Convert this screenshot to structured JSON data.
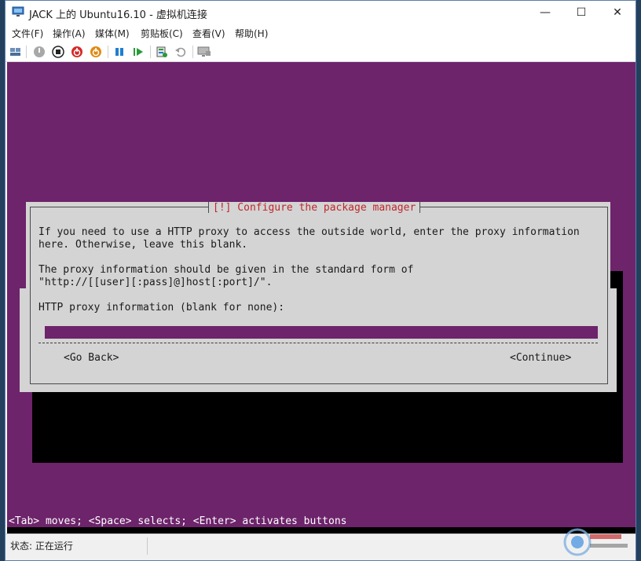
{
  "window": {
    "title": "JACK 上的 Ubuntu16.10 - 虚拟机连接",
    "minimize_glyph": "—",
    "maximize_glyph": "☐",
    "close_glyph": "✕"
  },
  "menu": {
    "items": [
      {
        "label": "文件(F)"
      },
      {
        "label": "操作(A)"
      },
      {
        "label": "媒体(M)"
      },
      {
        "label": "剪贴板(C)"
      },
      {
        "label": "查看(V)"
      },
      {
        "label": "帮助(H)"
      }
    ]
  },
  "toolbar": {
    "icons": [
      "ctrl-alt-del-icon",
      "start-icon",
      "turn-off-icon",
      "shut-down-icon",
      "power-icon",
      "pause-icon",
      "resume-icon",
      "checkpoint-icon",
      "revert-icon",
      "enhanced-session-icon"
    ]
  },
  "installer": {
    "dialog_title": "[!] Configure the package manager",
    "line1": "If you need to use a HTTP proxy to access the outside world, enter the proxy information",
    "line2": "here. Otherwise, leave this blank.",
    "line3": "The proxy information should be given in the standard form of",
    "line4": "\"http://[[user][:pass]@]host[:port]/\".",
    "prompt": "HTTP proxy information (blank for none):",
    "proxy_value": "",
    "back_label": "<Go Back>",
    "continue_label": "<Continue>",
    "hint": "<Tab> moves; <Space> selects; <Enter> activates buttons"
  },
  "statusbar": {
    "text": "状态: 正在运行"
  },
  "colors": {
    "screen_bg": "#6d246b",
    "dialog_bg": "#d4d4d4",
    "dialog_title": "#c0262b"
  }
}
